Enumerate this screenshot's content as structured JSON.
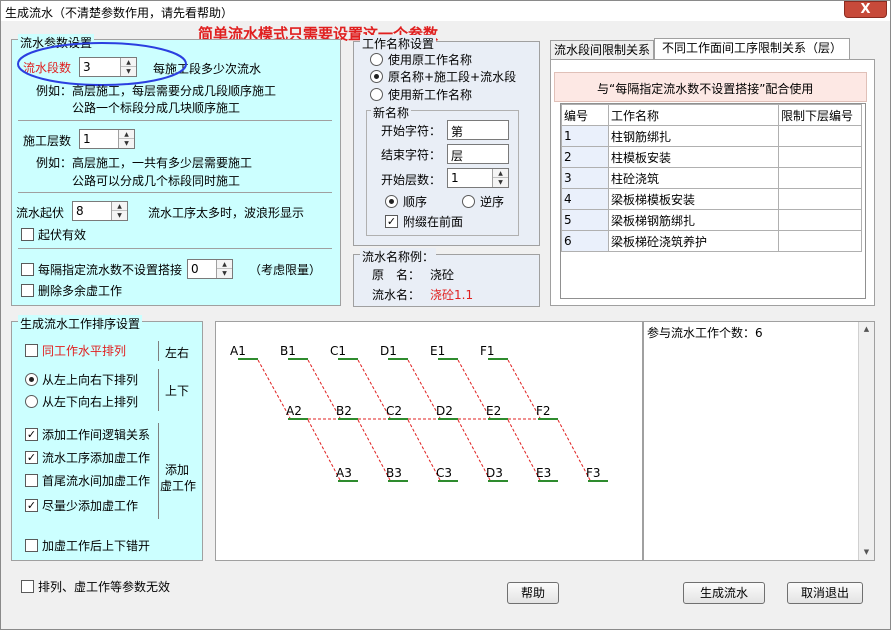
{
  "window": {
    "title": "生成流水（不清楚参数作用，请先看帮助）",
    "close_label": "X"
  },
  "hint_banner": "简单流水模式只需要设置这一个参数",
  "params": {
    "legend": "流水参数设置",
    "segments_label": "流水段数",
    "segments_value": "3",
    "segments_desc": "每施工段多少次流水",
    "segments_example_1": "例如：高层施工，每层需要分成几段顺序施工",
    "segments_example_2": "公路一个标段分成几块顺序施工",
    "layers_label": "施工层数",
    "layers_value": "1",
    "layers_example_1": "例如：高层施工，一共有多少层需要施工",
    "layers_example_2": "公路可以分成几个标段同时施工",
    "rise_label": "流水起伏",
    "rise_value": "8",
    "rise_desc": "流水工序太多时，波浪形显示",
    "rise_valid_label": "起伏有效",
    "rise_valid_checked": false,
    "interval_label": "每隔指定流水数不设置搭接",
    "interval_value": "0",
    "interval_note": "（考虑限量）",
    "interval_checked": false,
    "delete_dummy_label": "删除多余虚工作",
    "delete_dummy_checked": false
  },
  "naming": {
    "legend": "工作名称设置",
    "options": [
      {
        "label": "使用原工作名称",
        "selected": false
      },
      {
        "label": "原名称+施工段+流水段",
        "selected": true
      },
      {
        "label": "使用新工作名称",
        "selected": false
      }
    ],
    "new_name_legend": "新名称",
    "start_char_label": "开始字符：",
    "start_char_value": "第",
    "end_char_label": "结束字符：",
    "end_char_value": "层",
    "start_layer_label": "开始层数：",
    "start_layer_value": "1",
    "order_forward_label": "顺序",
    "order_forward_selected": true,
    "order_reverse_label": "逆序",
    "order_reverse_selected": false,
    "attach_front_label": "附缀在前面",
    "attach_front_checked": true
  },
  "example": {
    "legend": "流水名称例：",
    "original_label": "原　名：",
    "original_value": "浇砼",
    "flow_label": "流水名：",
    "flow_value": "浇砼1.1"
  },
  "tabs": [
    {
      "label": "流水段间限制关系",
      "active": false
    },
    {
      "label": "不同工作面间工序限制关系（层）",
      "active": true
    }
  ],
  "limit_notice": "与“每隔指定流水数不设置搭接”配合使用",
  "limit_table": {
    "headers": [
      "编号",
      "工作名称",
      "限制下层编号"
    ],
    "rows": [
      [
        "1",
        "柱钢筋绑扎",
        ""
      ],
      [
        "2",
        "柱模板安装",
        ""
      ],
      [
        "3",
        "柱砼浇筑",
        ""
      ],
      [
        "4",
        "梁板梯模板安装",
        ""
      ],
      [
        "5",
        "梁板梯钢筋绑扎",
        ""
      ],
      [
        "6",
        "梁板梯砼浇筑养护",
        ""
      ]
    ]
  },
  "sort": {
    "legend": "生成流水工作排序设置",
    "same_horizontal_label": "同工作水平排列",
    "same_horizontal_checked": false,
    "lr_label": "左右",
    "top_down_label": "从左上向右下排列",
    "top_down_selected": true,
    "bottom_up_label": "从左下向右上排列",
    "bottom_up_selected": false,
    "ud_label": "上下",
    "add_logic_label": "添加工作间逻辑关系",
    "add_logic_checked": true,
    "add_dummy_label": "流水工序添加虚工作",
    "add_dummy_checked": true,
    "head_tail_label": "首尾流水间加虚工作",
    "head_tail_checked": false,
    "minimize_label": "尽量少添加虚工作",
    "minimize_checked": true,
    "add_dummy_group_label_1": "添加",
    "add_dummy_group_label_2": "虚工作",
    "stagger_label": "加虚工作后上下错开",
    "stagger_checked": false
  },
  "diagram": {
    "rows": [
      [
        "A1",
        "B1",
        "C1",
        "D1",
        "E1",
        "F1"
      ],
      [
        "A2",
        "B2",
        "C2",
        "D2",
        "E2",
        "F2"
      ],
      [
        "A3",
        "B3",
        "C3",
        "D3",
        "E3",
        "F3"
      ]
    ],
    "line_color": "#2e8b2e",
    "link_color": "#e02020"
  },
  "info": {
    "count_text": "参与流水工作个数：6"
  },
  "footer": {
    "invalid_label": "排列、虚工作等参数无效",
    "invalid_checked": false,
    "help_label": "帮助",
    "generate_label": "生成流水",
    "cancel_label": "取消退出"
  }
}
